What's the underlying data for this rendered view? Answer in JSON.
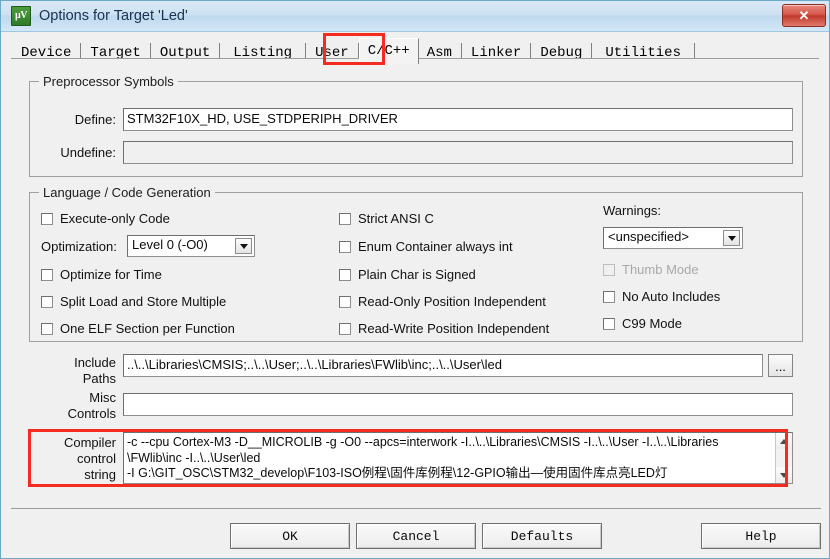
{
  "window": {
    "title": "Options for Target 'Led'",
    "icon": "keil-uvision-icon",
    "close_label": "✕",
    "accent": "#f42c20"
  },
  "tabs": [
    {
      "label": "Device",
      "selected": false
    },
    {
      "label": "Target",
      "selected": false
    },
    {
      "label": "Output",
      "selected": false
    },
    {
      "label": "Listing",
      "selected": false
    },
    {
      "label": "User",
      "selected": false
    },
    {
      "label": "C/C++",
      "selected": true
    },
    {
      "label": "Asm",
      "selected": false
    },
    {
      "label": "Linker",
      "selected": false
    },
    {
      "label": "Debug",
      "selected": false
    },
    {
      "label": "Utilities",
      "selected": false
    }
  ],
  "preprocessor": {
    "group_title": "Preprocessor Symbols",
    "define_label": "Define:",
    "define_value": "STM32F10X_HD, USE_STDPERIPH_DRIVER",
    "undefine_label": "Undefine:",
    "undefine_value": ""
  },
  "language": {
    "group_title": "Language / Code Generation",
    "left_checks": [
      {
        "label": "Execute-only Code",
        "checked": false,
        "disabled": false
      },
      {
        "label": "Optimize for Time",
        "checked": false,
        "disabled": false
      },
      {
        "label": "Split Load and Store Multiple",
        "checked": false,
        "disabled": false
      },
      {
        "label": "One ELF Section per Function",
        "checked": false,
        "disabled": false
      }
    ],
    "optimization_label": "Optimization:",
    "optimization_value": "Level 0 (-O0)",
    "middle_checks": [
      {
        "label": "Strict ANSI C",
        "checked": false,
        "disabled": false
      },
      {
        "label": "Enum Container always int",
        "checked": false,
        "disabled": false
      },
      {
        "label": "Plain Char is Signed",
        "checked": false,
        "disabled": false
      },
      {
        "label": "Read-Only Position Independent",
        "checked": false,
        "disabled": false
      },
      {
        "label": "Read-Write Position Independent",
        "checked": false,
        "disabled": false
      }
    ],
    "warnings_label": "Warnings:",
    "warnings_value": "<unspecified>",
    "right_checks": [
      {
        "label": "Thumb Mode",
        "checked": false,
        "disabled": true
      },
      {
        "label": "No Auto Includes",
        "checked": false,
        "disabled": false
      },
      {
        "label": "C99 Mode",
        "checked": false,
        "disabled": false
      }
    ]
  },
  "paths": {
    "include_label_line1": "Include",
    "include_label_line2": "Paths",
    "include_value": "..\\..\\Libraries\\CMSIS;..\\..\\User;..\\..\\Libraries\\FWlib\\inc;..\\..\\User\\led",
    "browse_label": "...",
    "misc_label_line1": "Misc",
    "misc_label_line2": "Controls",
    "misc_value": "",
    "compiler_label_line1": "Compiler",
    "compiler_label_line2": "control",
    "compiler_label_line3": "string",
    "compiler_lines": [
      "-c --cpu Cortex-M3 -D__MICROLIB -g -O0 --apcs=interwork -I..\\..\\Libraries\\CMSIS -I..\\..\\User -I..\\..\\Libraries",
      "\\FWlib\\inc -I..\\..\\User\\led",
      "-I G:\\GIT_OSC\\STM32_develop\\F103-ISO例程\\固件库例程\\12-GPIO输出—使用固件库点亮LED灯"
    ]
  },
  "footer": {
    "ok_label": "OK",
    "cancel_label": "Cancel",
    "defaults_label": "Defaults",
    "help_label": "Help"
  }
}
